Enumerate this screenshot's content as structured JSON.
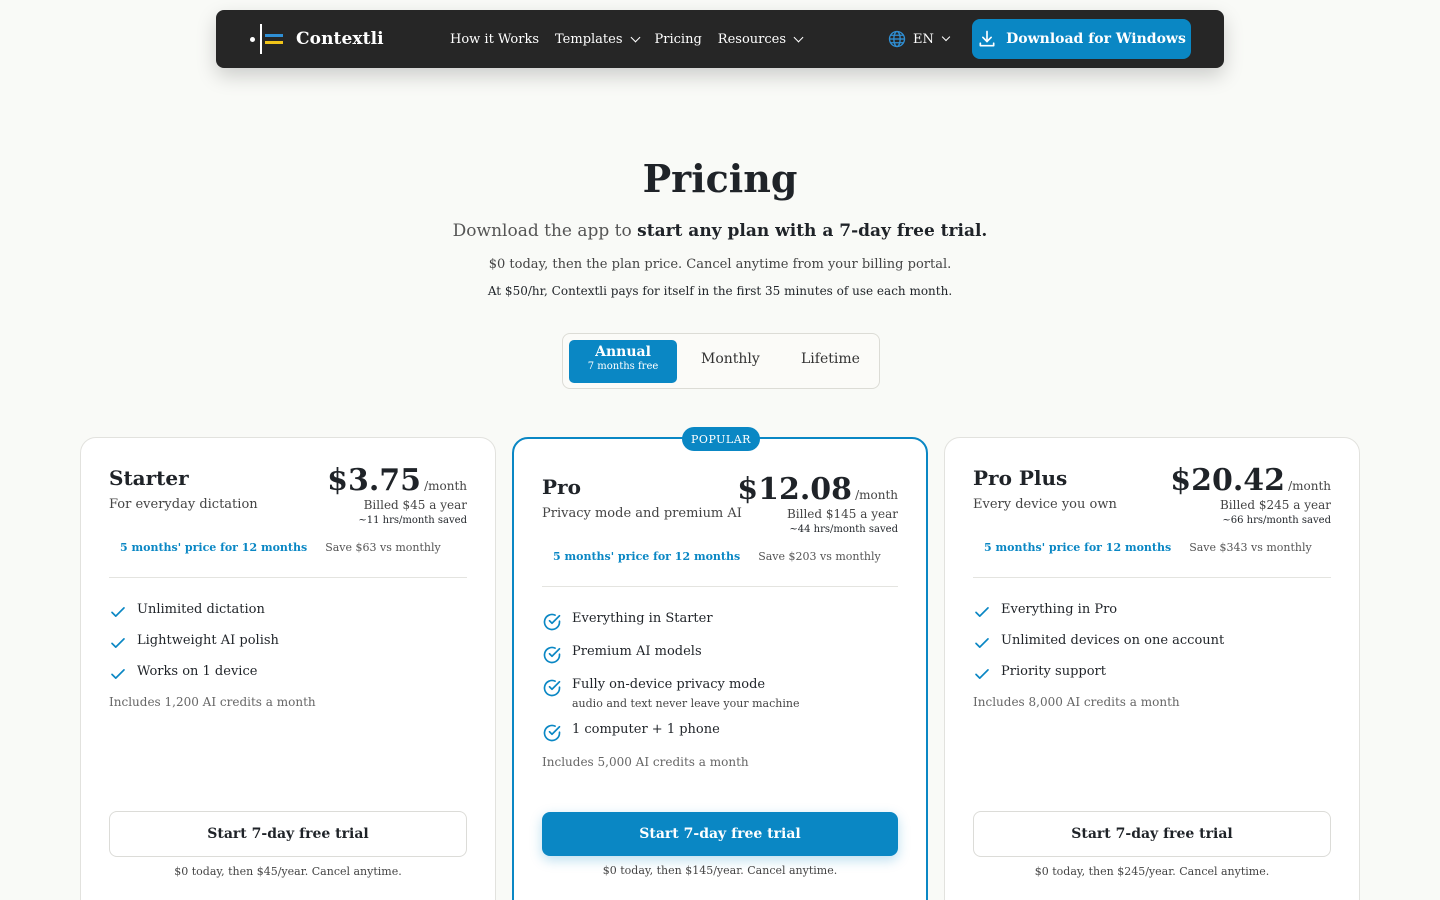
{
  "nav": {
    "brand": "Contextli",
    "links": [
      {
        "label": "How it Works",
        "dropdown": false
      },
      {
        "label": "Templates",
        "dropdown": true
      },
      {
        "label": "Pricing",
        "dropdown": false
      },
      {
        "label": "Resources",
        "dropdown": true
      }
    ],
    "language": "EN",
    "download_label": "Download for Windows"
  },
  "hero": {
    "title": "Pricing",
    "subtitle_prefix": "Download the app to ",
    "subtitle_bold": "start any plan with a 7-day free trial.",
    "line2": "$0 today, then the plan price. Cancel anytime from your billing portal.",
    "line3": "At $50/hr, Contextli pays for itself in the first 35 minutes of use each month."
  },
  "toggle": {
    "annual_label": "Annual",
    "annual_sub": "7 months free",
    "monthly_label": "Monthly",
    "lifetime_label": "Lifetime",
    "selected": "Annual"
  },
  "plans": [
    {
      "name": "Starter",
      "desc": "For everyday dictation",
      "price": "$3.75",
      "per": "/month",
      "billed": "Billed $45 a year",
      "saved": "~11 hrs/month saved",
      "deal": "5 months' price for 12 months",
      "save": "Save $63 vs monthly",
      "features": [
        {
          "text": "Unlimited dictation"
        },
        {
          "text": "Lightweight AI polish"
        },
        {
          "text": "Works on 1 device"
        }
      ],
      "credits": "Includes 1,200 AI credits a month",
      "cta": "Start 7-day free trial",
      "cta_note": "$0 today, then $45/year. Cancel anytime."
    },
    {
      "name": "Pro",
      "badge": "POPULAR",
      "desc": "Privacy mode and premium AI",
      "price": "$12.08",
      "per": "/month",
      "billed": "Billed $145 a year",
      "saved": "~44 hrs/month saved",
      "deal": "5 months' price for 12 months",
      "save": "Save $203 vs monthly",
      "features": [
        {
          "text": "Everything in Starter"
        },
        {
          "text": "Premium AI models"
        },
        {
          "text": "Fully on-device privacy mode",
          "note": "audio and text never leave your machine"
        },
        {
          "text": "1 computer + 1 phone"
        }
      ],
      "credits": "Includes 5,000 AI credits a month",
      "cta": "Start 7-day free trial",
      "cta_note": "$0 today, then $145/year. Cancel anytime."
    },
    {
      "name": "Pro Plus",
      "desc": "Every device you own",
      "price": "$20.42",
      "per": "/month",
      "billed": "Billed $245 a year",
      "saved": "~66 hrs/month saved",
      "deal": "5 months' price for 12 months",
      "save": "Save $343 vs monthly",
      "features": [
        {
          "text": "Everything in Pro"
        },
        {
          "text": "Unlimited devices on one account"
        },
        {
          "text": "Priority support"
        }
      ],
      "credits": "Includes 8,000 AI credits a month",
      "cta": "Start 7-day free trial",
      "cta_note": "$0 today, then $245/year. Cancel anytime."
    }
  ],
  "colors": {
    "accent": "#0a87c4",
    "nav_bg": "#262626",
    "page_bg": "#f9faf7"
  },
  "icons": {
    "logo": "contextli-logo-icon",
    "globe": "globe-icon",
    "download": "download-icon",
    "check": "check-icon",
    "check_circle": "check-circle-icon",
    "chevron": "chevron-down-icon"
  }
}
